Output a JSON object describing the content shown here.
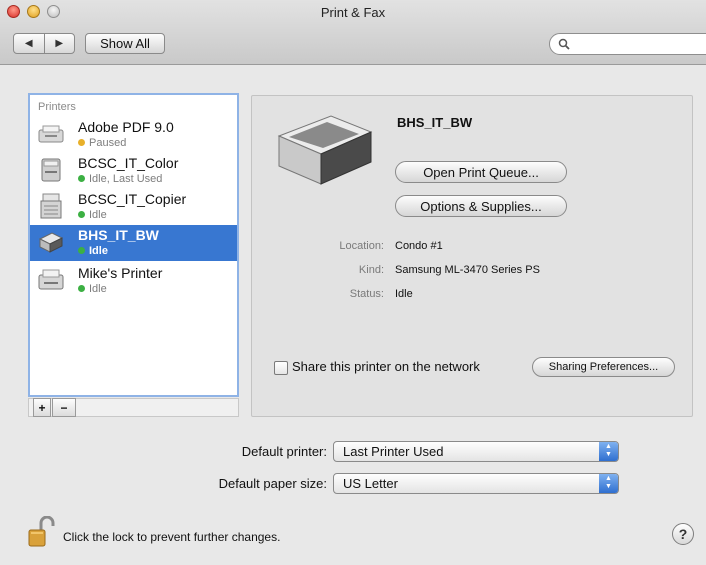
{
  "window": {
    "title": "Print & Fax"
  },
  "toolbar": {
    "show_all_label": "Show All",
    "search_placeholder": ""
  },
  "printers": {
    "header": "Printers",
    "items": [
      {
        "name": "Adobe PDF 9.0",
        "status": "Paused",
        "status_color": "#e8b02a",
        "icon": "pdf-printer-icon"
      },
      {
        "name": "BCSC_IT_Color",
        "status": "Idle, Last Used",
        "status_color": "#3cb043",
        "icon": "printer-icon"
      },
      {
        "name": "BCSC_IT_Copier",
        "status": "Idle",
        "status_color": "#3cb043",
        "icon": "copier-icon"
      },
      {
        "name": "BHS_IT_BW",
        "status": "Idle",
        "status_color": "#3cb043",
        "icon": "printer-icon",
        "selected": true
      },
      {
        "name": "Mike's Printer",
        "status": "Idle",
        "status_color": "#3cb043",
        "icon": "printer-icon"
      }
    ],
    "add_label": "+",
    "remove_label": "−"
  },
  "detail": {
    "printer_name": "BHS_IT_BW",
    "open_queue_label": "Open Print Queue...",
    "options_label": "Options & Supplies...",
    "location_label": "Location:",
    "location_value": "Condo #1",
    "kind_label": "Kind:",
    "kind_value": "Samsung ML-3470 Series PS",
    "status_label": "Status:",
    "status_value": "Idle",
    "share_label": "Share this printer on the network",
    "share_checked": false,
    "sharing_prefs_label": "Sharing Preferences..."
  },
  "defaults": {
    "printer_label": "Default printer:",
    "printer_value": "Last Printer Used",
    "paper_label": "Default paper size:",
    "paper_value": "US Letter"
  },
  "footer": {
    "lock_text": "Click the lock to prevent further changes.",
    "help_label": "?"
  },
  "colors": {
    "selection": "#3877d1",
    "accent": "#2f6fd0"
  }
}
